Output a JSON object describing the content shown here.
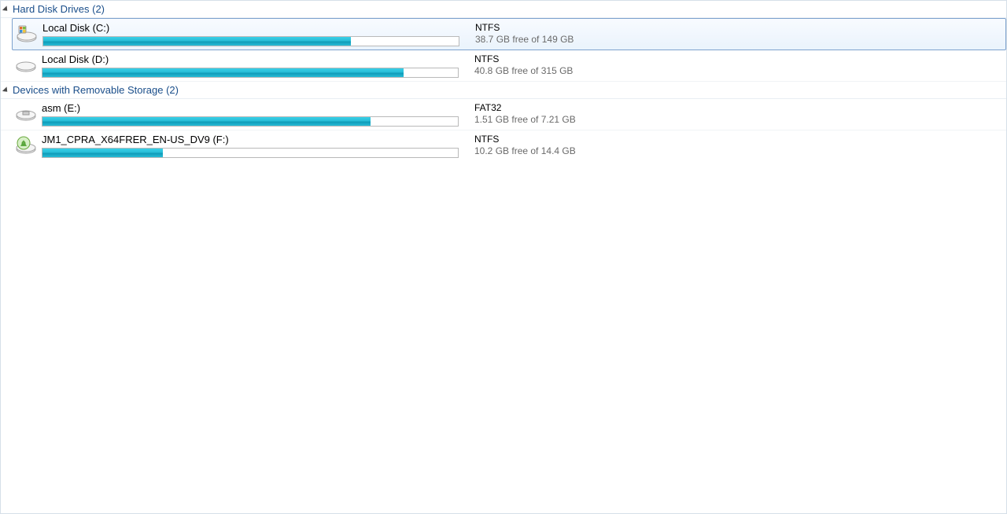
{
  "groups": [
    {
      "title": "Hard Disk Drives (2)",
      "id": "hdd-group",
      "drives": [
        {
          "id": "drive-c",
          "icon": "os-drive-icon",
          "name": "Local Disk (C:)",
          "fs": "NTFS",
          "space": "38.7 GB free of 149 GB",
          "fillPercent": 74,
          "selected": true
        },
        {
          "id": "drive-d",
          "icon": "hard-drive-icon",
          "name": "Local Disk (D:)",
          "fs": "NTFS",
          "space": "40.8 GB free of 315 GB",
          "fillPercent": 87,
          "selected": false
        }
      ]
    },
    {
      "title": "Devices with Removable Storage (2)",
      "id": "removable-group",
      "drives": [
        {
          "id": "drive-e",
          "icon": "removable-drive-icon",
          "name": "asm (E:)",
          "fs": "FAT32",
          "space": "1.51 GB free of 7.21 GB",
          "fillPercent": 79,
          "selected": false
        },
        {
          "id": "drive-f",
          "icon": "dvd-drive-icon",
          "name": "JM1_CPRA_X64FRER_EN-US_DV9 (F:)",
          "fs": "NTFS",
          "space": "10.2 GB free of 14.4 GB",
          "fillPercent": 29,
          "selected": false
        }
      ]
    }
  ]
}
